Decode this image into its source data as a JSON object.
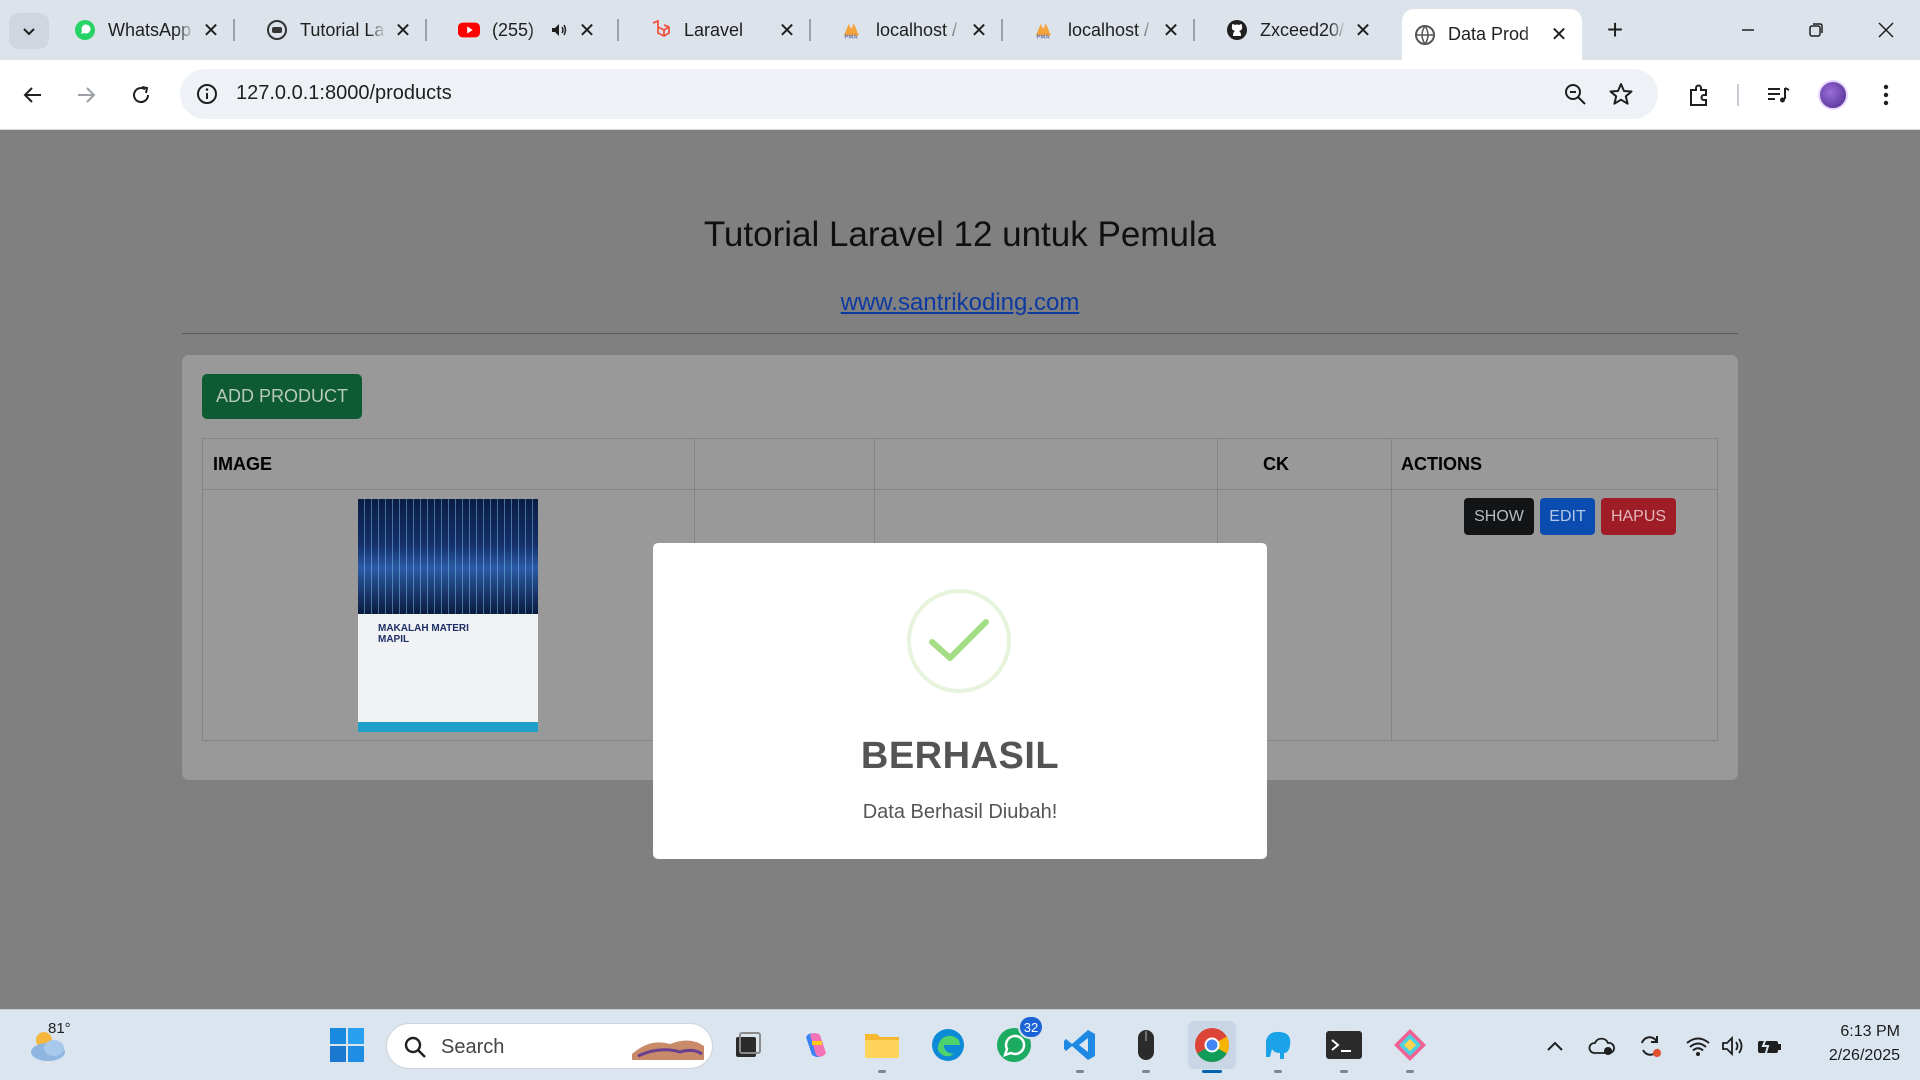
{
  "browser": {
    "tabs": [
      {
        "label": "WhatsApp",
        "icon": "whatsapp-icon",
        "active": false
      },
      {
        "label": "Tutorial La",
        "icon": "globe-icon",
        "active": false
      },
      {
        "label": "(255) ≡",
        "icon": "youtube-icon",
        "active": false
      },
      {
        "label": "Laravel",
        "icon": "laravel-icon",
        "active": false
      },
      {
        "label": "localhost /",
        "icon": "phpmyadmin-icon",
        "active": false
      },
      {
        "label": "localhost /",
        "icon": "phpmyadmin-icon",
        "active": false
      },
      {
        "label": "Zxceed20/",
        "icon": "github-icon",
        "active": false
      },
      {
        "label": "Data Prod",
        "icon": "globe-icon",
        "active": true
      }
    ],
    "url": "127.0.0.1:8000/products"
  },
  "page": {
    "title": "Tutorial Laravel 12 untuk Pemula",
    "link": "www.santrikoding.com",
    "add_button": "ADD PRODUCT",
    "table": {
      "headers": {
        "image": "IMAGE",
        "stock": "CK",
        "actions": "ACTIONS"
      },
      "row": {
        "thumb_title": "MAKALAH MATERI MAPIL",
        "actions": {
          "show": "SHOW",
          "edit": "EDIT",
          "hapus": "HAPUS"
        }
      }
    }
  },
  "modal": {
    "title": "BERHASIL",
    "message": "Data Berhasil Diubah!",
    "icon": "success-check-icon"
  },
  "taskbar": {
    "weather_temp": "81°",
    "search_placeholder": "Search",
    "whatsapp_badge": "32",
    "time": "6:13 PM",
    "date": "2/26/2025"
  },
  "colors": {
    "backdrop": "#808080",
    "add_button": "#0e5a32",
    "show_button": "#121416",
    "edit_button": "#0b4cb0",
    "hapus_button": "#9e1d27",
    "check": "#a5dc86"
  }
}
